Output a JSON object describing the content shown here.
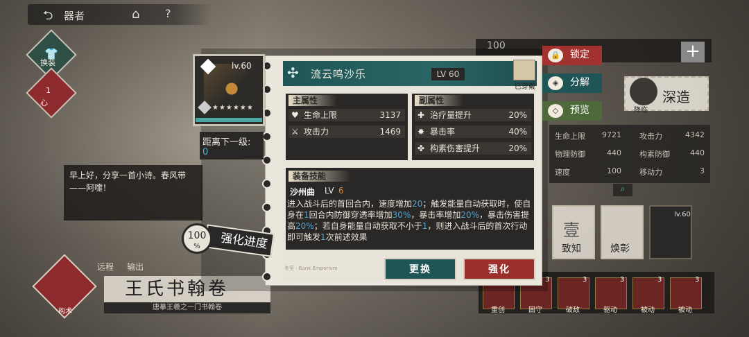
{
  "topbar": {
    "back_icon": "back-arrow-icon",
    "title": "器者",
    "home_icon": "home-icon",
    "help_icon": "?"
  },
  "side": {
    "btn1_label": "换装",
    "btn2_badge": "1",
    "btn2_label": "心"
  },
  "chat": {
    "text": "早上好，分享一首小诗。春风带——阿嚏！"
  },
  "tags": [
    "远程",
    "输出"
  ],
  "book": {
    "name": "王氏书翰卷",
    "subtitle": "唐摹王羲之一门书翰卷",
    "emblem_label": "构术"
  },
  "right_panel": {
    "top_number": "100",
    "plus": "+",
    "deepen_label": "深造",
    "deepen_sub": "降临",
    "stats": [
      {
        "name": "生命上限",
        "value": "9721"
      },
      {
        "name": "攻击力",
        "value": "4342"
      },
      {
        "name": "物理防御",
        "value": "440"
      },
      {
        "name": "构素防御",
        "value": "440"
      },
      {
        "name": "速度",
        "value": "100"
      },
      {
        "name": "移动力",
        "value": "3"
      }
    ],
    "slots": [
      {
        "big": "壹",
        "label": "致知"
      },
      {
        "big": "",
        "label": "焕彰"
      },
      {
        "big": "",
        "label": "lv.60"
      }
    ],
    "bottom_items": [
      {
        "label": "重创",
        "num": ""
      },
      {
        "label": "固守",
        "num": "3"
      },
      {
        "label": "破敌",
        "num": "3"
      },
      {
        "label": "驱动",
        "num": "3"
      },
      {
        "label": "被动",
        "num": "3"
      },
      {
        "label": "被动",
        "num": "3"
      }
    ]
  },
  "modal": {
    "card": {
      "lv": "lv.60",
      "stars": "★★★★★★",
      "progress": 1.0
    },
    "next_level": {
      "label": "距离下一级:",
      "value": "0"
    },
    "progress_badge": {
      "percent": "100",
      "unit": "%",
      "label": "强化进度"
    },
    "header": {
      "name": "流云鸣沙乐",
      "lv": "LV 60",
      "worn": "已穿戴"
    },
    "main_attr": {
      "title": "主属性",
      "rows": [
        {
          "icon": "heart-icon",
          "glyph": "♥",
          "name": "生命上限",
          "value": "3137"
        },
        {
          "icon": "swords-icon",
          "glyph": "⚔",
          "name": "攻击力",
          "value": "1469"
        }
      ]
    },
    "sub_attr": {
      "title": "副属性",
      "rows": [
        {
          "icon": "heal-icon",
          "glyph": "✚",
          "name": "治疗量提升",
          "value": "20%"
        },
        {
          "icon": "crit-icon",
          "glyph": "✸",
          "name": "暴击率",
          "value": "40%"
        },
        {
          "icon": "element-dmg-icon",
          "glyph": "✤",
          "name": "构素伤害提升",
          "value": "20%"
        }
      ]
    },
    "skill": {
      "title": "装备技能",
      "name": "沙州曲",
      "lv_label": "LV",
      "lv_value": "6",
      "desc_parts": [
        {
          "t": "进入战斗后的首回合内，速度增加",
          "h": false
        },
        {
          "t": "20",
          "h": true
        },
        {
          "t": "；触发能量自动获取时，使自身在",
          "h": false
        },
        {
          "t": "1",
          "h": true
        },
        {
          "t": "回合内防御穿透率增加",
          "h": false
        },
        {
          "t": "30%",
          "h": true
        },
        {
          "t": "，暴击率增加",
          "h": false
        },
        {
          "t": "20%",
          "h": true
        },
        {
          "t": "，暴击伤害提高",
          "h": false
        },
        {
          "t": "20%",
          "h": true
        },
        {
          "t": "；若自身能量自动获取不小于",
          "h": false
        },
        {
          "t": "1",
          "h": true
        },
        {
          "t": "，则进入战斗后的首次行动即可触发",
          "h": false
        },
        {
          "t": "1",
          "h": true
        },
        {
          "t": "次前述效果",
          "h": false
        }
      ]
    },
    "footer_strip": "冬至  ·  Bank Emporium",
    "buttons": {
      "replace": "更换",
      "enhance": "强化"
    }
  },
  "side_tabs": {
    "lock": "锁定",
    "decompose": "分解",
    "preview": "预览"
  },
  "colors": {
    "teal": "#1f5557",
    "red": "#9a2f2b",
    "highlight": "#4ba6d0",
    "lv_orange": "#e38a3a"
  }
}
